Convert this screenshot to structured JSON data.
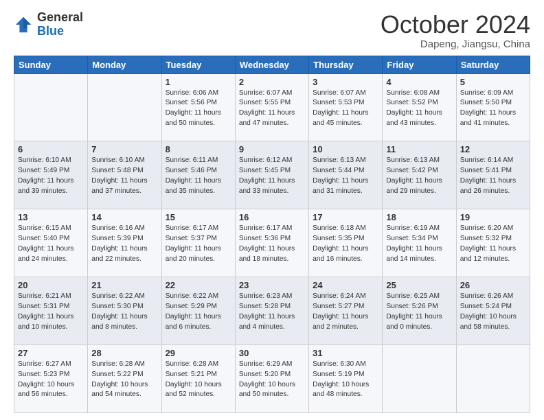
{
  "logo": {
    "general": "General",
    "blue": "Blue"
  },
  "header": {
    "month": "October 2024",
    "location": "Dapeng, Jiangsu, China"
  },
  "days": [
    "Sunday",
    "Monday",
    "Tuesday",
    "Wednesday",
    "Thursday",
    "Friday",
    "Saturday"
  ],
  "weeks": [
    [
      {
        "day": "",
        "info": ""
      },
      {
        "day": "",
        "info": ""
      },
      {
        "day": "1",
        "info": "Sunrise: 6:06 AM\nSunset: 5:56 PM\nDaylight: 11 hours and 50 minutes."
      },
      {
        "day": "2",
        "info": "Sunrise: 6:07 AM\nSunset: 5:55 PM\nDaylight: 11 hours and 47 minutes."
      },
      {
        "day": "3",
        "info": "Sunrise: 6:07 AM\nSunset: 5:53 PM\nDaylight: 11 hours and 45 minutes."
      },
      {
        "day": "4",
        "info": "Sunrise: 6:08 AM\nSunset: 5:52 PM\nDaylight: 11 hours and 43 minutes."
      },
      {
        "day": "5",
        "info": "Sunrise: 6:09 AM\nSunset: 5:50 PM\nDaylight: 11 hours and 41 minutes."
      }
    ],
    [
      {
        "day": "6",
        "info": "Sunrise: 6:10 AM\nSunset: 5:49 PM\nDaylight: 11 hours and 39 minutes."
      },
      {
        "day": "7",
        "info": "Sunrise: 6:10 AM\nSunset: 5:48 PM\nDaylight: 11 hours and 37 minutes."
      },
      {
        "day": "8",
        "info": "Sunrise: 6:11 AM\nSunset: 5:46 PM\nDaylight: 11 hours and 35 minutes."
      },
      {
        "day": "9",
        "info": "Sunrise: 6:12 AM\nSunset: 5:45 PM\nDaylight: 11 hours and 33 minutes."
      },
      {
        "day": "10",
        "info": "Sunrise: 6:13 AM\nSunset: 5:44 PM\nDaylight: 11 hours and 31 minutes."
      },
      {
        "day": "11",
        "info": "Sunrise: 6:13 AM\nSunset: 5:42 PM\nDaylight: 11 hours and 29 minutes."
      },
      {
        "day": "12",
        "info": "Sunrise: 6:14 AM\nSunset: 5:41 PM\nDaylight: 11 hours and 26 minutes."
      }
    ],
    [
      {
        "day": "13",
        "info": "Sunrise: 6:15 AM\nSunset: 5:40 PM\nDaylight: 11 hours and 24 minutes."
      },
      {
        "day": "14",
        "info": "Sunrise: 6:16 AM\nSunset: 5:39 PM\nDaylight: 11 hours and 22 minutes."
      },
      {
        "day": "15",
        "info": "Sunrise: 6:17 AM\nSunset: 5:37 PM\nDaylight: 11 hours and 20 minutes."
      },
      {
        "day": "16",
        "info": "Sunrise: 6:17 AM\nSunset: 5:36 PM\nDaylight: 11 hours and 18 minutes."
      },
      {
        "day": "17",
        "info": "Sunrise: 6:18 AM\nSunset: 5:35 PM\nDaylight: 11 hours and 16 minutes."
      },
      {
        "day": "18",
        "info": "Sunrise: 6:19 AM\nSunset: 5:34 PM\nDaylight: 11 hours and 14 minutes."
      },
      {
        "day": "19",
        "info": "Sunrise: 6:20 AM\nSunset: 5:32 PM\nDaylight: 11 hours and 12 minutes."
      }
    ],
    [
      {
        "day": "20",
        "info": "Sunrise: 6:21 AM\nSunset: 5:31 PM\nDaylight: 11 hours and 10 minutes."
      },
      {
        "day": "21",
        "info": "Sunrise: 6:22 AM\nSunset: 5:30 PM\nDaylight: 11 hours and 8 minutes."
      },
      {
        "day": "22",
        "info": "Sunrise: 6:22 AM\nSunset: 5:29 PM\nDaylight: 11 hours and 6 minutes."
      },
      {
        "day": "23",
        "info": "Sunrise: 6:23 AM\nSunset: 5:28 PM\nDaylight: 11 hours and 4 minutes."
      },
      {
        "day": "24",
        "info": "Sunrise: 6:24 AM\nSunset: 5:27 PM\nDaylight: 11 hours and 2 minutes."
      },
      {
        "day": "25",
        "info": "Sunrise: 6:25 AM\nSunset: 5:26 PM\nDaylight: 11 hours and 0 minutes."
      },
      {
        "day": "26",
        "info": "Sunrise: 6:26 AM\nSunset: 5:24 PM\nDaylight: 10 hours and 58 minutes."
      }
    ],
    [
      {
        "day": "27",
        "info": "Sunrise: 6:27 AM\nSunset: 5:23 PM\nDaylight: 10 hours and 56 minutes."
      },
      {
        "day": "28",
        "info": "Sunrise: 6:28 AM\nSunset: 5:22 PM\nDaylight: 10 hours and 54 minutes."
      },
      {
        "day": "29",
        "info": "Sunrise: 6:28 AM\nSunset: 5:21 PM\nDaylight: 10 hours and 52 minutes."
      },
      {
        "day": "30",
        "info": "Sunrise: 6:29 AM\nSunset: 5:20 PM\nDaylight: 10 hours and 50 minutes."
      },
      {
        "day": "31",
        "info": "Sunrise: 6:30 AM\nSunset: 5:19 PM\nDaylight: 10 hours and 48 minutes."
      },
      {
        "day": "",
        "info": ""
      },
      {
        "day": "",
        "info": ""
      }
    ]
  ]
}
